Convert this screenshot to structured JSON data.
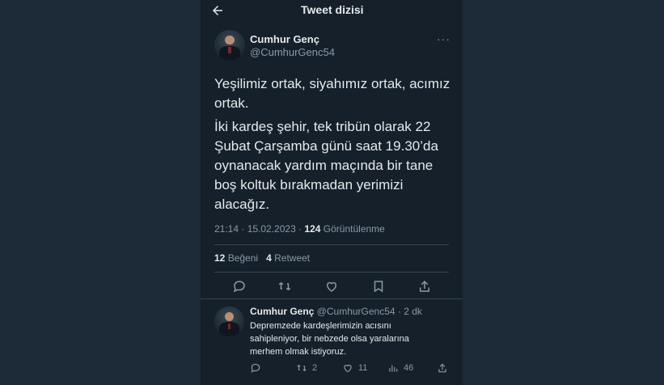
{
  "header": {
    "title": "Tweet dizisi"
  },
  "tweet": {
    "name": "Cumhur Genç",
    "handle": "@CumhurGenc54",
    "more": "···",
    "paragraph1": "Yeşilimiz ortak, siyahımız ortak, acımız ortak.",
    "paragraph2": "İki kardeş şehir, tek tribün olarak 22 Şubat Çarşamba günü saat 19.30’da oynanacak yardım maçında bir tane boş koltuk bırakmadan yerimizi alacağız.",
    "meta_time": "21:14 · 15.02.2023 · ",
    "views_count": "124",
    "views_label": " Görüntülenme",
    "likes_count": "12",
    "likes_label": " Beğeni",
    "retweets_count": "4",
    "retweets_label": " Retweet"
  },
  "reply": {
    "name": "Cumhur Genç",
    "handle": "@CumhurGenc54 · 2 dk",
    "text": "Depremzede kardeşlerimizin acısını sahipleniyor, bir nebzede olsa yaralarına merhem olmak istiyoruz.",
    "retweets": "2",
    "likes": "11",
    "views": "46"
  },
  "colors": {
    "page_bg": "#1d2a38",
    "panel_bg": "#15202b",
    "text": "#e7e9ea",
    "muted": "#8b98a5"
  }
}
